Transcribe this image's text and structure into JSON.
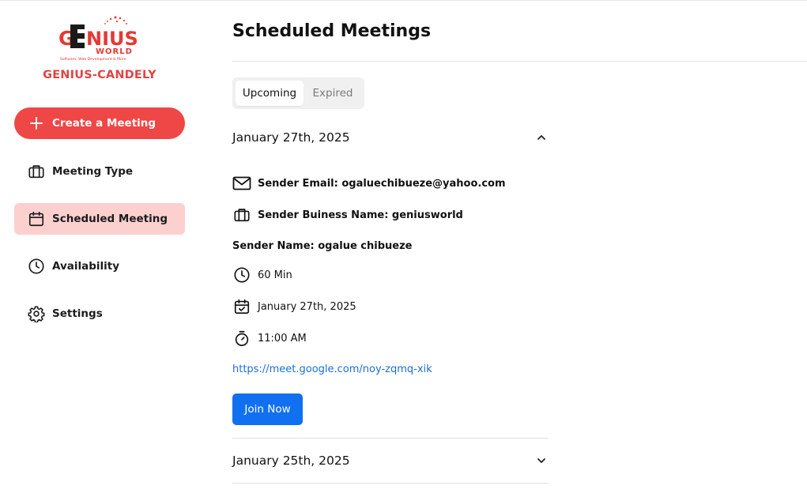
{
  "sidebar": {
    "logo": {
      "wordmark": "GENIUS",
      "sub": "WORLD",
      "tagline": "Software, Web Development & More"
    },
    "brand_name": "GENIUS-CANDELY",
    "create_label": "Create a Meeting",
    "items": [
      {
        "label": "Meeting Type",
        "icon": "briefcase-icon"
      },
      {
        "label": "Scheduled Meeting",
        "icon": "calendar-icon",
        "active": true
      },
      {
        "label": "Availability",
        "icon": "clock-icon"
      },
      {
        "label": "Settings",
        "icon": "gear-icon"
      }
    ]
  },
  "page": {
    "title": "Scheduled Meetings"
  },
  "tabs": [
    {
      "label": "Upcoming",
      "active": true
    },
    {
      "label": "Expired",
      "active": false
    }
  ],
  "meetings": [
    {
      "date_heading": "January 27th, 2025",
      "expanded": true,
      "sender_email": "Sender Email: ogaluechibueze@yahoo.com",
      "sender_business": "Sender Buiness Name: geniusworld",
      "sender_name": "Sender Name: ogalue chibueze",
      "duration": "60 Min",
      "date": "January 27th, 2025",
      "time": "11:00 AM",
      "link": "https://meet.google.com/noy-zqmq-xik",
      "join_label": "Join Now"
    },
    {
      "date_heading": "January 25th, 2025",
      "expanded": false
    }
  ],
  "colors": {
    "accent_red": "#ef4646",
    "brand_red": "#e04444",
    "active_nav_bg": "#fdd0d0",
    "join_blue": "#1170f0",
    "link_blue": "#1a6fd8"
  }
}
